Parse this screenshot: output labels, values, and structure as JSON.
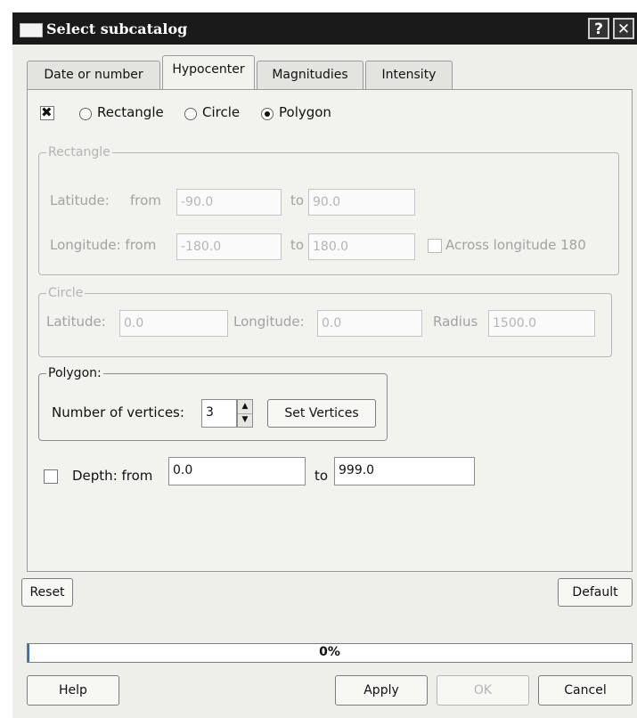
{
  "window": {
    "title": "Select subcatalog",
    "help_glyph": "?",
    "close_glyph": "✕"
  },
  "tabs": [
    {
      "label": "Date or number",
      "active": false
    },
    {
      "label": "Hypocenter",
      "active": true
    },
    {
      "label": "Magnitudies",
      "active": false
    },
    {
      "label": "Intensity",
      "active": false
    }
  ],
  "region": {
    "enabled": true,
    "options": [
      "Rectangle",
      "Circle",
      "Polygon"
    ],
    "selected": "Polygon"
  },
  "rectangle": {
    "legend": "Rectangle",
    "latitude_label": "Latitude:",
    "from_label": "from",
    "lat_from": "-90.0",
    "to_label": "to",
    "lat_to": "90.0",
    "longitude_label": "Longitude: from",
    "lon_from": "-180.0",
    "lon_to": "180.0",
    "across_label": "Across longitude 180",
    "across_checked": false
  },
  "circle": {
    "legend": "Circle",
    "latitude_label": "Latitude:",
    "latitude": "0.0",
    "longitude_label": "Longitude:",
    "longitude": "0.0",
    "radius_label": "Radius",
    "radius": "1500.0"
  },
  "polygon": {
    "legend": "Polygon:",
    "vertices_label": "Number of vertices:",
    "vertices": "3",
    "set_vertices_label": "Set Vertices"
  },
  "depth": {
    "checked": false,
    "label": "Depth: from",
    "from": "0.0",
    "to_label": "to",
    "to": "999.0"
  },
  "buttons": {
    "reset": "Reset",
    "default": "Default",
    "help": "Help",
    "apply": "Apply",
    "ok": "OK",
    "cancel": "Cancel"
  },
  "progress": {
    "text": "0%",
    "value": 0.0
  }
}
